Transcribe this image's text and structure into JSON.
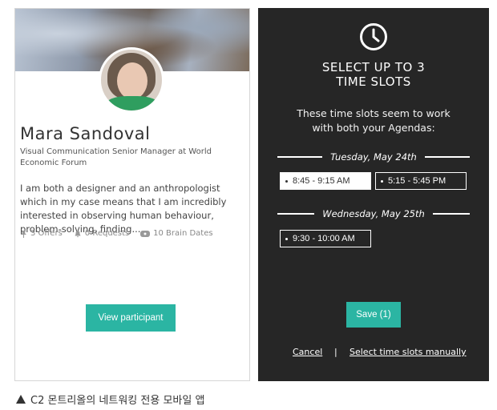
{
  "profile": {
    "name": "Mara Sandoval",
    "title": "Visual Communication Senior Manager at World Economic Forum",
    "bio": "I am both a designer and an anthropologist which in my case means that I am incredibly interested in observing human behaviour, problem-solving, finding...",
    "stats": {
      "offers": "3 Offers",
      "requests": "0 Requests",
      "brain_dates": "10 Brain Dates"
    },
    "view_button": "View participant"
  },
  "picker": {
    "heading_line1": "SELECT UP TO 3",
    "heading_line2": "TIME SLOTS",
    "sub_line1": "These time slots seem to work",
    "sub_line2": "with both your Agendas:",
    "days": [
      {
        "date": "Tuesday, May 24th",
        "slots": [
          {
            "label": "8:45 - 9:15 AM",
            "selected": true
          },
          {
            "label": "5:15 - 5:45 PM",
            "selected": false
          }
        ]
      },
      {
        "date": "Wednesday, May 25th",
        "slots": [
          {
            "label": "9:30 - 10:00 AM",
            "selected": false
          }
        ]
      }
    ],
    "save_button": "Save (1)",
    "cancel": "Cancel",
    "separator": "|",
    "manual": "Select time slots manually"
  },
  "caption": "C2 몬트리올의 네트워킹 전용 모바일 앱",
  "colors": {
    "accent": "#2bb5a3",
    "panel_bg": "#262626"
  }
}
